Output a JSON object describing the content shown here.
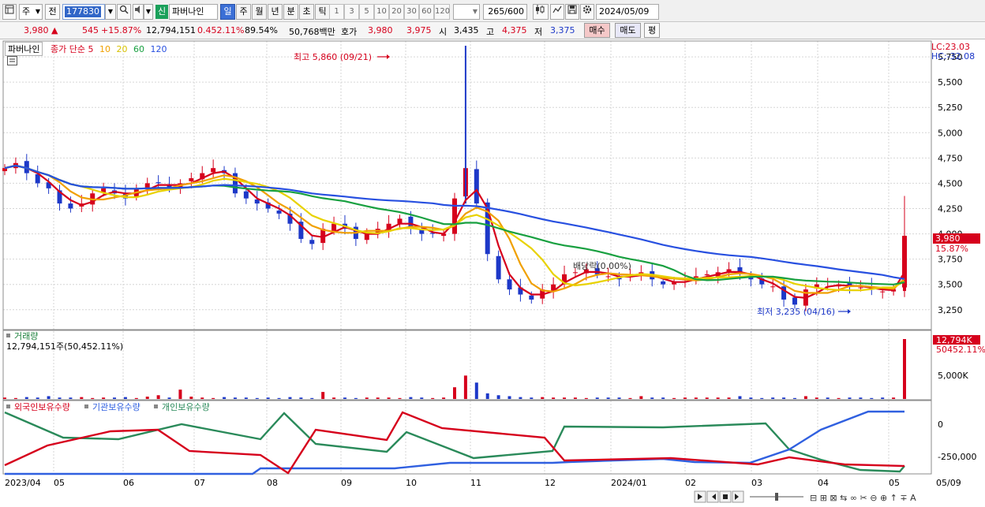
{
  "toolbar": {
    "market_select": "주",
    "prev_label": "전",
    "stock_code": "177830",
    "new_badge": "신",
    "stock_name": "파버나인",
    "period_tabs": [
      "일",
      "주",
      "월",
      "년",
      "분",
      "초",
      "틱"
    ],
    "active_tab": "일",
    "interval_numbers": [
      "1",
      "3",
      "5",
      "10",
      "20",
      "30",
      "60",
      "120"
    ],
    "bar_count": "265",
    "bar_total": "/600",
    "date": "2024/05/09"
  },
  "quote": {
    "price": "3,980",
    "change_arrow": "▲",
    "change": "545",
    "change_pct": "+15.87%",
    "volume": "12,794,151",
    "turnover_pct": "0.452.11%",
    "ratio": "89.54%",
    "amount": "50,768백만",
    "hoga_label": "호가",
    "hoga_ask": "3,980",
    "hoga_bid": "3,975",
    "open_label": "시",
    "open": "3,435",
    "high_label": "고",
    "high": "4,375",
    "low_label": "저",
    "low": "3,375",
    "buy_label": "매수",
    "sell_label": "매도",
    "eval_label": "평"
  },
  "legend": {
    "title": "파버나인",
    "ma_label": "종가 단순",
    "ma_periods": [
      "5",
      "10",
      "20",
      "60",
      "120"
    ],
    "ma_colors": [
      "#d6001c",
      "#f0a000",
      "#e8d200",
      "#18a040",
      "#2850e0"
    ]
  },
  "price_panel": {
    "lc": "LC:23.03",
    "hc": "HC:-32.08",
    "y_ticks": [
      "5,750",
      "5,500",
      "5,250",
      "5,000",
      "4,750",
      "4,500",
      "4,250",
      "4,000",
      "3,750",
      "3,500",
      "3,250"
    ],
    "current_price_tag": "3,980",
    "current_pct_tag": "15.87%",
    "high_note": "최고 5,860 (09/21)",
    "low_note": "최저 3,235 (04/16)",
    "dividend_note": "배당락(0.00%)"
  },
  "volume_panel": {
    "title": "거래량",
    "value_text": "12,794,151주(50,452.11%)",
    "tag_value": "12,794K",
    "tag_pct": "50452.11%",
    "y_ticks": [
      "5,000K"
    ]
  },
  "holdings_panel": {
    "series": [
      "외국인보유수량",
      "기관보유수량",
      "개인보유수량"
    ],
    "colors": [
      "#d6001c",
      "#3060e0",
      "#2a8a5a"
    ],
    "y_ticks": [
      "0",
      "-250,000"
    ]
  },
  "x_axis": {
    "labels": [
      "2023/04",
      "05",
      "06",
      "07",
      "08",
      "09",
      "10",
      "11",
      "12",
      "2024/01",
      "02",
      "03",
      "04",
      "05",
      "05/09"
    ]
  },
  "colors": {
    "up": "#d6001c",
    "down": "#1d38c8",
    "grid": "#d6d6d6",
    "panel_border": "#8c8c8c"
  },
  "chart_data": {
    "type": "candlestick",
    "title": "파버나인",
    "y_range": [
      3100,
      5860
    ],
    "close": [
      4650,
      4700,
      4600,
      4500,
      4450,
      4300,
      4250,
      4300,
      4400,
      4450,
      4400,
      4350,
      4450,
      4500,
      4500,
      4450,
      4500,
      4550,
      4600,
      4650,
      4600,
      4400,
      4350,
      4300,
      4250,
      4200,
      4100,
      3950,
      3900,
      4050,
      4100,
      4050,
      3950,
      4000,
      4050,
      4100,
      4150,
      4050,
      4000,
      4000,
      4000,
      4350,
      4650,
      4300,
      3800,
      3550,
      3450,
      3400,
      3350,
      3450,
      3500,
      3600,
      3620,
      3650,
      3600,
      3580,
      3550,
      3600,
      3620,
      3550,
      3500,
      3520,
      3550,
      3580,
      3600,
      3620,
      3650,
      3600,
      3550,
      3500,
      3480,
      3350,
      3300,
      3450,
      3500,
      3480,
      3500,
      3480,
      3470,
      3450,
      3430,
      3450,
      3980
    ],
    "volume": [
      0.3,
      0.2,
      0.4,
      0.3,
      0.6,
      0.3,
      0.3,
      0.4,
      0.2,
      0.3,
      0.3,
      0.4,
      0.2,
      0.5,
      0.8,
      0.3,
      2.0,
      0.5,
      0.3,
      0.2,
      0.4,
      0.3,
      0.3,
      0.2,
      0.3,
      0.2,
      0.4,
      0.3,
      0.2,
      1.5,
      0.3,
      0.3,
      0.2,
      0.3,
      0.3,
      0.3,
      0.2,
      0.4,
      0.3,
      0.2,
      0.3,
      2.5,
      5.0,
      3.5,
      1.2,
      0.8,
      0.6,
      0.4,
      0.3,
      0.4,
      0.3,
      0.3,
      0.3,
      0.2,
      0.3,
      0.3,
      0.3,
      0.2,
      0.6,
      0.3,
      0.3,
      0.2,
      0.3,
      0.3,
      0.3,
      0.3,
      0.3,
      0.6,
      0.3,
      0.2,
      0.3,
      0.3,
      0.2,
      0.6,
      0.3,
      0.3,
      0.2,
      0.3,
      0.3,
      0.2,
      0.3,
      0.3,
      12.8
    ],
    "volume_unit": "M shares"
  }
}
